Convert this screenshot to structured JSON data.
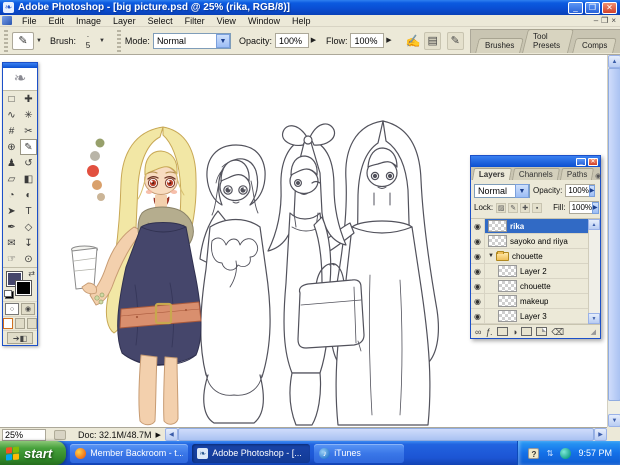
{
  "window": {
    "title": "Adobe Photoshop - [big picture.psd @ 25% (rika, RGB/8)]",
    "controls": {
      "minimize": "_",
      "restore": "❒",
      "close": "✕"
    },
    "doc_controls": {
      "minimize": "–",
      "restore": "❐",
      "close": "×"
    }
  },
  "menus": [
    "File",
    "Edit",
    "Image",
    "Layer",
    "Select",
    "Filter",
    "View",
    "Window",
    "Help"
  ],
  "options_bar": {
    "tool_glyph": "✎",
    "brush_label": "Brush:",
    "brush_size": "5",
    "mode_label": "Mode:",
    "mode_value": "Normal",
    "opacity_label": "Opacity:",
    "opacity_value": "100%",
    "flow_label": "Flow:",
    "flow_value": "100%",
    "airbrush_glyph": "✍",
    "file_icon_glyph": "▤",
    "toggle_icon_glyph": "✎"
  },
  "palette_well": {
    "tabs": [
      "Brushes",
      "Tool Presets",
      "Comps"
    ]
  },
  "tools": [
    {
      "name": "rectangular-marquee",
      "glyph": "□"
    },
    {
      "name": "move",
      "glyph": "✚"
    },
    {
      "name": "lasso",
      "glyph": "∿"
    },
    {
      "name": "magic-wand",
      "glyph": "✳"
    },
    {
      "name": "crop",
      "glyph": "#"
    },
    {
      "name": "slice",
      "glyph": "✂"
    },
    {
      "name": "healing-brush",
      "glyph": "⊕"
    },
    {
      "name": "brush",
      "glyph": "✎",
      "selected": true
    },
    {
      "name": "clone-stamp",
      "glyph": "♟"
    },
    {
      "name": "history-brush",
      "glyph": "↺"
    },
    {
      "name": "eraser",
      "glyph": "▱"
    },
    {
      "name": "gradient",
      "glyph": "◧"
    },
    {
      "name": "blur",
      "glyph": "◔"
    },
    {
      "name": "dodge",
      "glyph": "◐"
    },
    {
      "name": "path-selection",
      "glyph": "➤"
    },
    {
      "name": "type",
      "glyph": "T"
    },
    {
      "name": "pen",
      "glyph": "✒"
    },
    {
      "name": "shape",
      "glyph": "◇"
    },
    {
      "name": "notes",
      "glyph": "✉"
    },
    {
      "name": "eyedropper",
      "glyph": "↧"
    },
    {
      "name": "hand",
      "glyph": "☞"
    },
    {
      "name": "zoom",
      "glyph": "⊙"
    }
  ],
  "toolbox": {
    "foreground_color": "#45466b",
    "background_color": "#000000"
  },
  "layers_palette": {
    "tabs": [
      "Layers",
      "Channels",
      "Paths"
    ],
    "blend_mode": "Normal",
    "opacity_label": "Opacity:",
    "opacity_value": "100%",
    "lock_label": "Lock:",
    "fill_label": "Fill:",
    "fill_value": "100%",
    "layers": [
      {
        "name": "rika",
        "selected": true
      },
      {
        "name": "sayoko and riiya"
      },
      {
        "name": "chouette",
        "group": true
      },
      {
        "name": "Layer 2",
        "child": true
      },
      {
        "name": "chouette",
        "child": true
      },
      {
        "name": "makeup",
        "child": true
      },
      {
        "name": "Layer 3",
        "child": true
      }
    ]
  },
  "status_bar": {
    "zoom": "25%",
    "doc_info": "Doc: 32.1M/48.7M"
  },
  "taskbar": {
    "start_label": "start",
    "tasks": [
      {
        "label": "Member Backroom - t...",
        "active": false
      },
      {
        "label": "Adobe Photoshop - [...",
        "active": true
      },
      {
        "label": "iTunes",
        "active": false
      }
    ],
    "tray_time": "9:57 PM"
  },
  "colors": {
    "xp_titlebar_blue": "#0b4fd0",
    "taskbar_blue": "#1c55d4",
    "start_green": "#2e8326",
    "selection_blue": "#316ac5",
    "panel_tan": "#ece9d8",
    "artwork_palette": [
      "#97a06b",
      "#b9b5a8",
      "#e2503f",
      "#d9a06b",
      "#cbb597"
    ],
    "artwork_dress_navy": "#45466b",
    "artwork_belt_salmon": "#d98f6e",
    "artwork_hair_blonde": "#f2e7a5",
    "artwork_scarf_olive": "#b5ad8e",
    "artwork_skin": "#f3d0ad"
  }
}
